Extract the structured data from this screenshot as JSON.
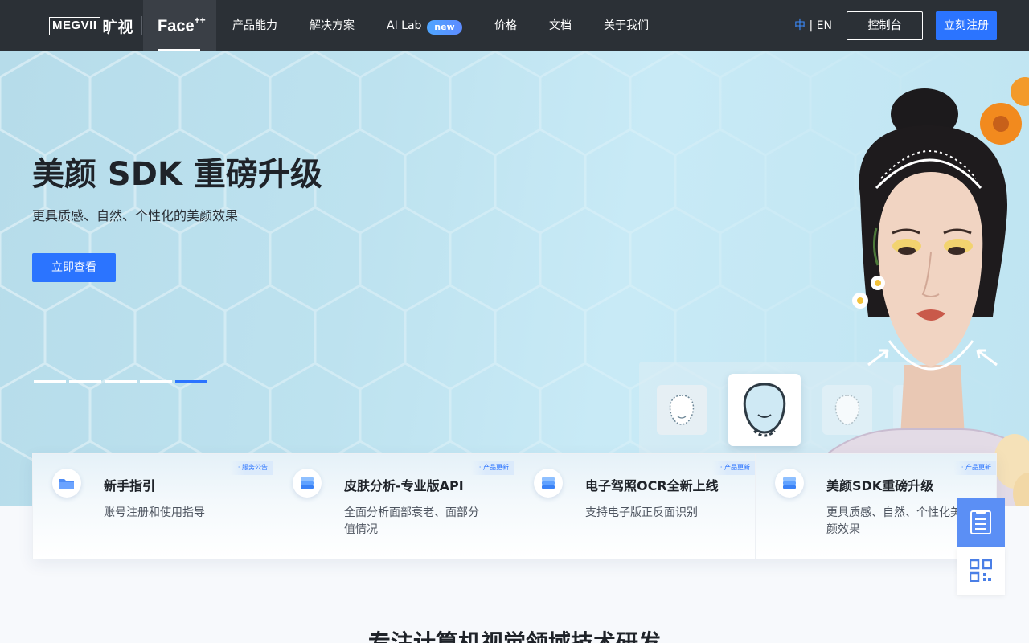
{
  "nav": {
    "brand_latin": "MEGVII",
    "brand_cn": "旷视",
    "product_name": "Face",
    "product_sup": "++",
    "links": [
      "产品能力",
      "解决方案",
      "AI Lab",
      "价格",
      "文档",
      "关于我们"
    ],
    "ai_lab_badge": "new",
    "lang_cn": "中",
    "lang_sep": " | ",
    "lang_en": "EN",
    "console_label": "控制台",
    "signup_label": "立刻注册"
  },
  "hero": {
    "title": "美颜 SDK 重磅升级",
    "subtitle": "更具质感、自然、个性化的美颜效果",
    "cta_label": "立即查看",
    "slide_count": 5,
    "active_slide": 5
  },
  "cards": [
    {
      "icon": "folder-icon",
      "tag": "· 服务公告",
      "title": "新手指引",
      "desc": "账号注册和使用指导"
    },
    {
      "icon": "stack-icon",
      "tag": "· 产品更新",
      "title": "皮肤分析-专业版API",
      "desc": "全面分析面部衰老、面部分值情况"
    },
    {
      "icon": "stack-icon",
      "tag": "· 产品更新",
      "title": "电子驾照OCR全新上线",
      "desc": "支持电子版正反面识别"
    },
    {
      "icon": "stack-icon",
      "tag": "· 产品更新",
      "title": "美颜SDK重磅升级",
      "desc": "更具质感、自然、个性化美颜效果"
    }
  ],
  "section": {
    "title": "专注计算机视觉领域技术研发"
  },
  "colors": {
    "nav_bg": "#2b3036",
    "accent": "#2b74ff",
    "hero_bg": "#bde2ef"
  }
}
